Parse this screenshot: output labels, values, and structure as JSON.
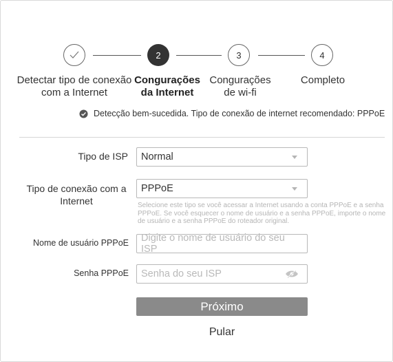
{
  "steps": [
    {
      "number": "✓",
      "label": "Detectar tipo de conexão com a Internet",
      "state": "done"
    },
    {
      "number": "2",
      "label": "Congurações da Internet",
      "state": "active"
    },
    {
      "number": "3",
      "label": "Congurações de wi-fi",
      "state": "todo"
    },
    {
      "number": "4",
      "label": "Completo",
      "state": "todo"
    }
  ],
  "status": {
    "text": "Detecção bem-sucedida. Tipo de conexão de internet recomendado: PPPoE",
    "icon": "check-circle-icon"
  },
  "form": {
    "isp_type": {
      "label": "Tipo de ISP",
      "value": "Normal"
    },
    "connection_type": {
      "label": "Tipo de conexão com a Internet",
      "value": "PPPoE",
      "hint": "Selecione este tipo se você acessar a Internet usando a conta PPPoE e a senha PPPoE. Se você esquecer o nome de usuário e a senha PPPoE, importe o nome de usuário e a senha PPPoE do roteador original."
    },
    "username": {
      "label": "Nome de usuário PPPoE",
      "placeholder": "Digite o nome de usuário do seu ISP"
    },
    "password": {
      "label": "Senha PPPoE",
      "placeholder": "Senha do seu ISP",
      "icon": "eye-hidden-icon"
    }
  },
  "buttons": {
    "next": "Próximo",
    "skip": "Pular"
  },
  "colors": {
    "active_step": "#333333",
    "button_bg": "#8a8a8a",
    "placeholder": "#b9b9b9"
  }
}
